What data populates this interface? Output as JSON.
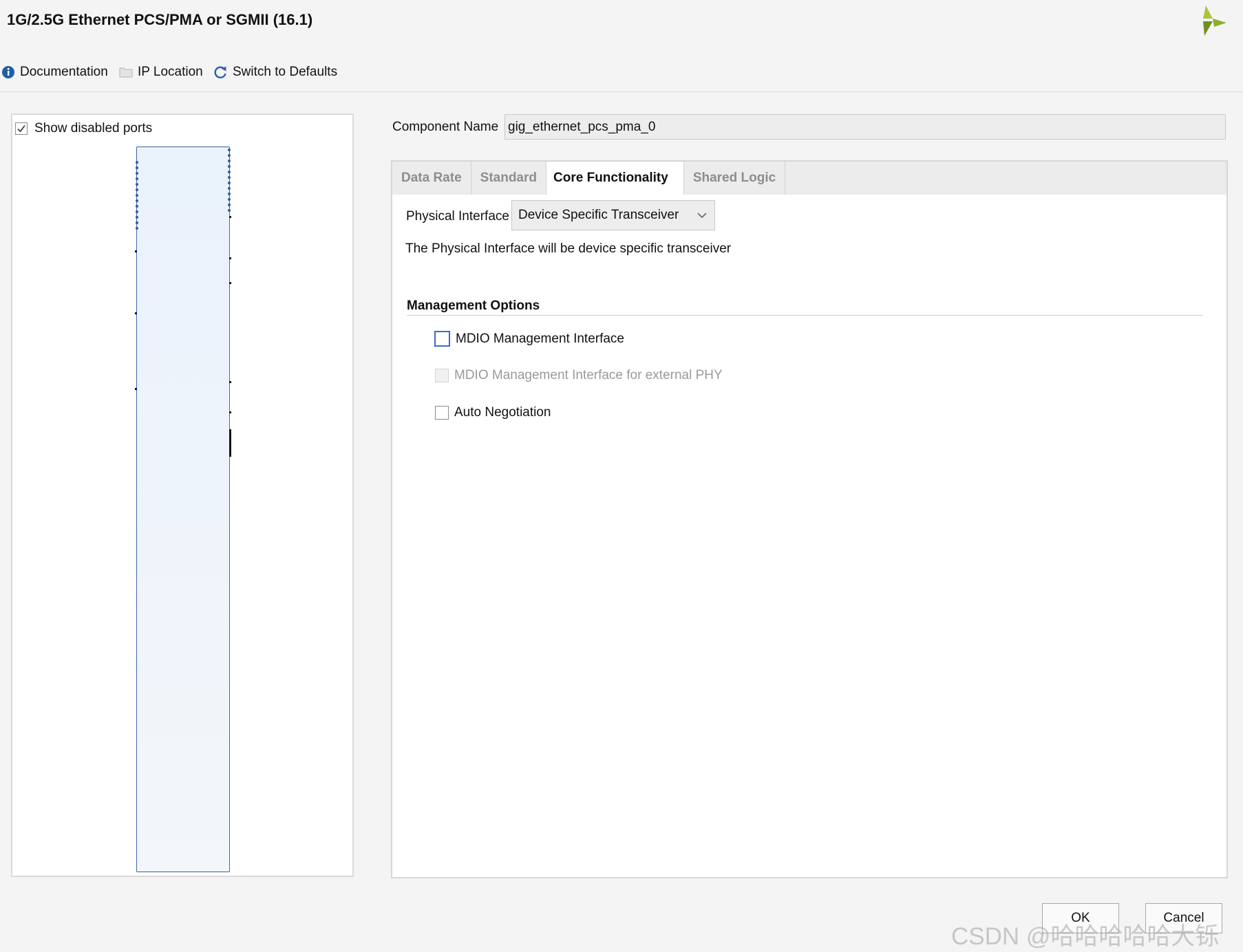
{
  "window": {
    "title": "1G/2.5G Ethernet PCS/PMA or SGMII (16.1)"
  },
  "toolbar": {
    "documentation": "Documentation",
    "ip_location": "IP Location",
    "switch_defaults": "Switch to Defaults"
  },
  "left_panel": {
    "show_disabled_ports": "Show disabled ports",
    "show_disabled_ports_checked": true
  },
  "component": {
    "label": "Component Name",
    "value": "gig_ethernet_pcs_pma_0"
  },
  "tabs": [
    {
      "label": "Data Rate",
      "active": false
    },
    {
      "label": "Standard",
      "active": false
    },
    {
      "label": "Core Functionality",
      "active": true
    },
    {
      "label": "Shared Logic",
      "active": false
    }
  ],
  "core": {
    "physical_interface_label": "Physical Interface",
    "physical_interface_value": "Device Specific Transceiver",
    "description": "The Physical Interface will be device specific transceiver",
    "management_heading": "Management Options",
    "options": {
      "mdio": {
        "label": "MDIO Management Interface",
        "checked": false,
        "enabled": true
      },
      "mdio_ext_phy": {
        "label": "MDIO Management Interface for external PHY",
        "checked": false,
        "enabled": false
      },
      "auto_neg": {
        "label": "Auto Negotiation",
        "checked": false,
        "enabled": true
      }
    }
  },
  "buttons": {
    "ok": "OK",
    "cancel": "Cancel"
  },
  "watermark": "CSDN @哈哈哈哈哈大铄",
  "colors": {
    "accent": "#3b6bc8",
    "logo_green": "#8dae2d",
    "info_icon": "#1f5fa8"
  }
}
